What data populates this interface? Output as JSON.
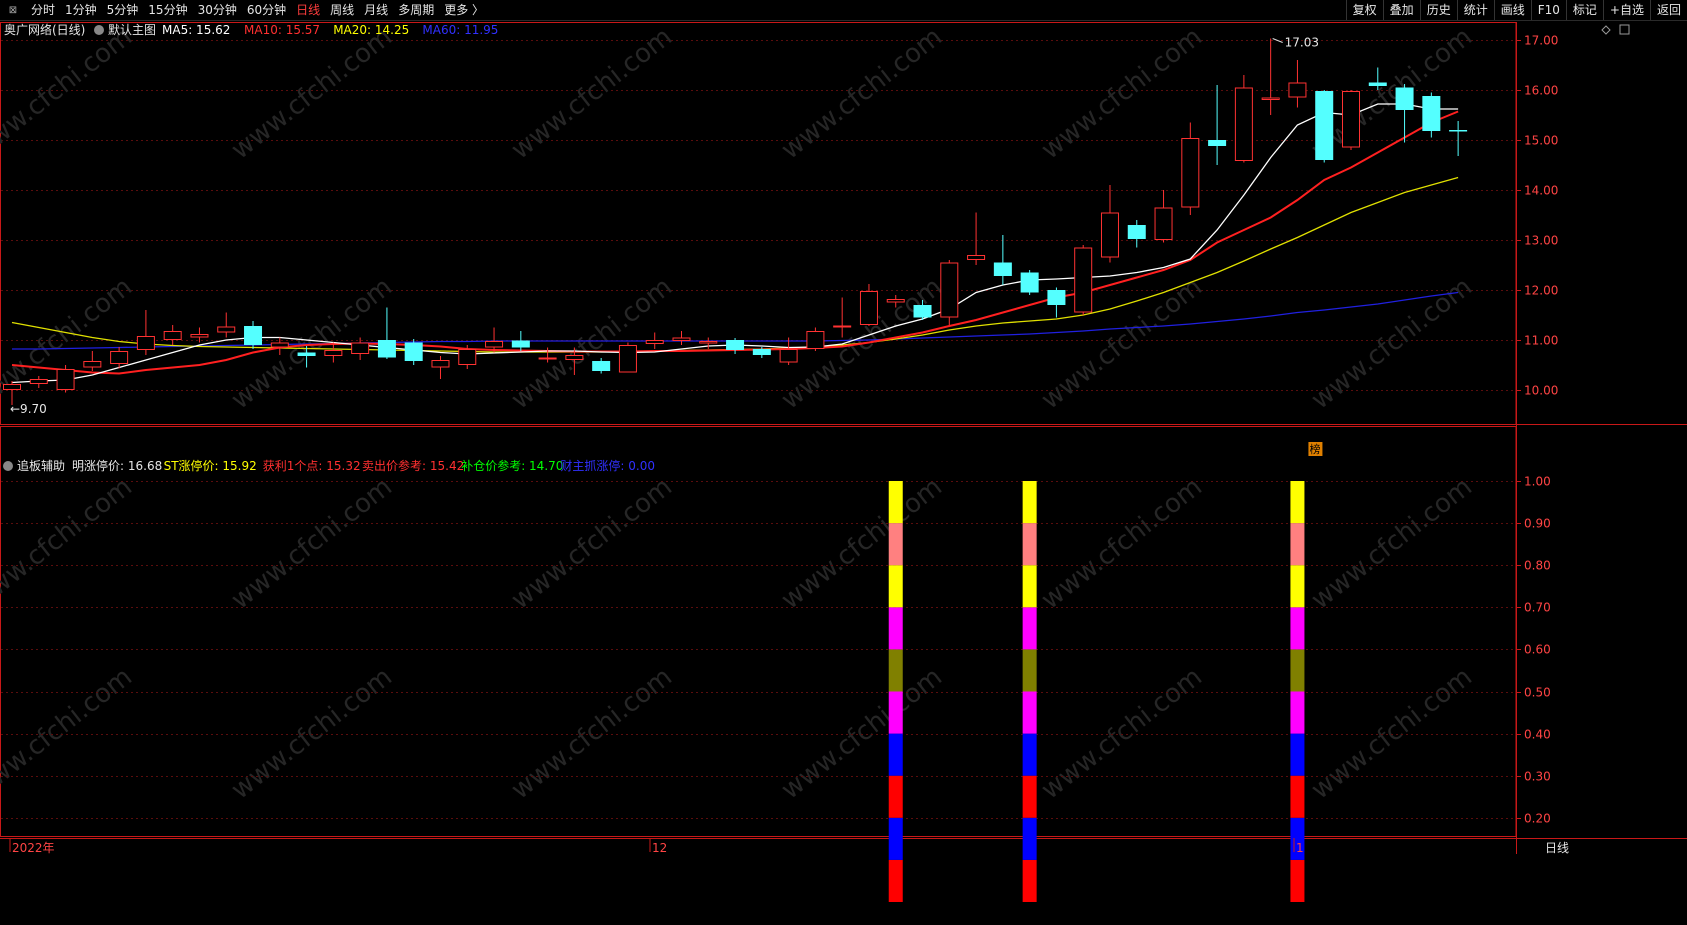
{
  "toolbar": {
    "left_items": [
      "分时",
      "1分钟",
      "5分钟",
      "15分钟",
      "30分钟",
      "60分钟",
      "日线",
      "周线",
      "月线",
      "多周期",
      "更多 〉"
    ],
    "active_index": 6,
    "right_items": [
      "复权",
      "叠加",
      "历史",
      "统计",
      "画线",
      "F10",
      "标记",
      "+自选",
      "返回"
    ]
  },
  "main_panel": {
    "stock_title": "奥广网络(日线)",
    "template_label": "默认主图",
    "ma_labels": [
      {
        "text": "MA5: 15.62",
        "color": "#ffffff"
      },
      {
        "text": "MA10: 15.57",
        "color": "#ff3030"
      },
      {
        "text": "MA20: 14.25",
        "color": "#ffff00"
      },
      {
        "text": "MA60: 11.95",
        "color": "#3030ff"
      }
    ],
    "high_label": "17.03",
    "low_label": "9.70",
    "tag_label": "榜"
  },
  "indicator_panel": {
    "name": "追板辅助",
    "labels": [
      {
        "text": "明涨停价: 16.68",
        "color": "#e6e6e6"
      },
      {
        "text": "ST涨停价: 15.92",
        "color": "#ffff00"
      },
      {
        "text": "获利1个点: 15.32",
        "color": "#ff3030"
      },
      {
        "text": "卖出价参考: 15.42",
        "color": "#ff3030"
      },
      {
        "text": "补仓价参考: 14.70",
        "color": "#00ff00"
      },
      {
        "text": "财主抓涨停: 0.00",
        "color": "#3030ff"
      }
    ]
  },
  "time_axis": {
    "labels": [
      "2022年",
      "12",
      "1"
    ],
    "period_label": "日线"
  },
  "watermark": "www.cfchi.com",
  "chart_data": [
    {
      "type": "candlestick",
      "ylim": [
        9.4,
        17.2
      ],
      "yticks": [
        10.0,
        11.0,
        12.0,
        13.0,
        14.0,
        15.0,
        16.0,
        17.0
      ],
      "candles": [
        {
          "o": 10.0,
          "h": 10.18,
          "l": 9.7,
          "c": 10.12
        },
        {
          "o": 10.12,
          "h": 10.28,
          "l": 10.04,
          "c": 10.22
        },
        {
          "o": 10.0,
          "h": 10.5,
          "l": 9.95,
          "c": 10.42
        },
        {
          "o": 10.45,
          "h": 10.78,
          "l": 10.38,
          "c": 10.58
        },
        {
          "o": 10.52,
          "h": 10.86,
          "l": 10.43,
          "c": 10.78
        },
        {
          "o": 10.8,
          "h": 11.6,
          "l": 10.7,
          "c": 11.08
        },
        {
          "o": 11.0,
          "h": 11.3,
          "l": 10.9,
          "c": 11.18
        },
        {
          "o": 11.05,
          "h": 11.25,
          "l": 10.95,
          "c": 11.12
        },
        {
          "o": 11.15,
          "h": 11.55,
          "l": 11.05,
          "c": 11.27
        },
        {
          "o": 11.28,
          "h": 11.38,
          "l": 10.82,
          "c": 10.9
        },
        {
          "o": 10.85,
          "h": 11.05,
          "l": 10.7,
          "c": 10.95
        },
        {
          "o": 10.75,
          "h": 10.88,
          "l": 10.45,
          "c": 10.68
        },
        {
          "o": 10.68,
          "h": 10.95,
          "l": 10.55,
          "c": 10.8
        },
        {
          "o": 10.72,
          "h": 11.05,
          "l": 10.6,
          "c": 10.95
        },
        {
          "o": 11.0,
          "h": 11.65,
          "l": 10.62,
          "c": 10.65
        },
        {
          "o": 10.95,
          "h": 11.02,
          "l": 10.5,
          "c": 10.58
        },
        {
          "o": 10.45,
          "h": 10.68,
          "l": 10.22,
          "c": 10.6
        },
        {
          "o": 10.5,
          "h": 10.9,
          "l": 10.42,
          "c": 10.82
        },
        {
          "o": 10.85,
          "h": 11.25,
          "l": 10.75,
          "c": 10.98
        },
        {
          "o": 10.99,
          "h": 11.18,
          "l": 10.78,
          "c": 10.85
        },
        {
          "o": 10.65,
          "h": 10.85,
          "l": 10.55,
          "c": 10.65
        },
        {
          "o": 10.6,
          "h": 10.85,
          "l": 10.3,
          "c": 10.7
        },
        {
          "o": 10.58,
          "h": 10.64,
          "l": 10.33,
          "c": 10.38
        },
        {
          "o": 10.35,
          "h": 10.95,
          "l": 10.35,
          "c": 10.9
        },
        {
          "o": 10.92,
          "h": 11.15,
          "l": 10.82,
          "c": 11.0
        },
        {
          "o": 10.98,
          "h": 11.18,
          "l": 10.9,
          "c": 11.05
        },
        {
          "o": 10.93,
          "h": 11.05,
          "l": 10.82,
          "c": 10.98
        },
        {
          "o": 11.0,
          "h": 11.04,
          "l": 10.72,
          "c": 10.8
        },
        {
          "o": 10.82,
          "h": 10.86,
          "l": 10.64,
          "c": 10.7
        },
        {
          "o": 10.55,
          "h": 11.05,
          "l": 10.5,
          "c": 10.82
        },
        {
          "o": 10.82,
          "h": 11.25,
          "l": 10.78,
          "c": 11.18
        },
        {
          "o": 11.27,
          "h": 11.85,
          "l": 11.05,
          "c": 11.29
        },
        {
          "o": 11.3,
          "h": 12.12,
          "l": 11.28,
          "c": 11.98
        },
        {
          "o": 11.75,
          "h": 11.9,
          "l": 11.65,
          "c": 11.82
        },
        {
          "o": 11.7,
          "h": 11.8,
          "l": 11.4,
          "c": 11.45
        },
        {
          "o": 11.45,
          "h": 12.6,
          "l": 11.3,
          "c": 12.55
        },
        {
          "o": 12.6,
          "h": 13.55,
          "l": 12.5,
          "c": 12.7
        },
        {
          "o": 12.55,
          "h": 13.1,
          "l": 12.1,
          "c": 12.28
        },
        {
          "o": 12.35,
          "h": 12.4,
          "l": 11.9,
          "c": 11.95
        },
        {
          "o": 12.0,
          "h": 12.05,
          "l": 11.45,
          "c": 11.7
        },
        {
          "o": 11.55,
          "h": 12.9,
          "l": 11.5,
          "c": 12.85
        },
        {
          "o": 12.65,
          "h": 14.1,
          "l": 12.55,
          "c": 13.55
        },
        {
          "o": 13.3,
          "h": 13.4,
          "l": 12.85,
          "c": 13.02
        },
        {
          "o": 13.0,
          "h": 14.0,
          "l": 12.95,
          "c": 13.65
        },
        {
          "o": 13.65,
          "h": 15.35,
          "l": 13.5,
          "c": 15.04
        },
        {
          "o": 15.0,
          "h": 16.1,
          "l": 14.5,
          "c": 14.88
        },
        {
          "o": 14.58,
          "h": 16.3,
          "l": 14.55,
          "c": 16.05
        },
        {
          "o": 15.8,
          "h": 17.03,
          "l": 15.5,
          "c": 15.85
        },
        {
          "o": 15.85,
          "h": 16.6,
          "l": 15.65,
          "c": 16.15
        },
        {
          "o": 15.98,
          "h": 16.0,
          "l": 14.55,
          "c": 14.6
        },
        {
          "o": 14.85,
          "h": 16.0,
          "l": 14.8,
          "c": 15.98
        },
        {
          "o": 16.15,
          "h": 16.45,
          "l": 16.0,
          "c": 16.08
        },
        {
          "o": 16.05,
          "h": 16.12,
          "l": 14.95,
          "c": 15.6
        },
        {
          "o": 15.88,
          "h": 15.95,
          "l": 15.05,
          "c": 15.18
        },
        {
          "o": 15.2,
          "h": 15.38,
          "l": 14.68,
          "c": 15.18
        }
      ],
      "ma5": [
        10.15,
        10.18,
        10.2,
        10.3,
        10.45,
        10.6,
        10.75,
        10.9,
        11.0,
        11.05,
        11.05,
        11.0,
        10.95,
        10.9,
        10.85,
        10.8,
        10.75,
        10.72,
        10.74,
        10.76,
        10.78,
        10.78,
        10.76,
        10.75,
        10.76,
        10.82,
        10.88,
        10.9,
        10.88,
        10.85,
        10.86,
        10.92,
        11.1,
        11.28,
        11.42,
        11.62,
        11.95,
        12.1,
        12.2,
        12.22,
        12.25,
        12.28,
        12.35,
        12.45,
        12.62,
        13.2,
        13.9,
        14.65,
        15.3,
        15.55,
        15.5,
        15.72,
        15.72,
        15.62,
        15.62
      ],
      "ma10": [
        10.5,
        10.45,
        10.4,
        10.35,
        10.33,
        10.4,
        10.45,
        10.5,
        10.6,
        10.75,
        10.85,
        10.9,
        10.92,
        10.93,
        10.92,
        10.9,
        10.87,
        10.82,
        10.8,
        10.79,
        10.78,
        10.77,
        10.77,
        10.77,
        10.78,
        10.78,
        10.79,
        10.8,
        10.81,
        10.82,
        10.84,
        10.87,
        10.95,
        11.05,
        11.15,
        11.28,
        11.4,
        11.55,
        11.7,
        11.85,
        11.95,
        12.1,
        12.25,
        12.4,
        12.6,
        12.95,
        13.2,
        13.45,
        13.8,
        14.2,
        14.45,
        14.75,
        15.05,
        15.35,
        15.57
      ],
      "ma20": [
        11.35,
        11.25,
        11.15,
        11.05,
        10.97,
        10.92,
        10.89,
        10.87,
        10.86,
        10.85,
        10.84,
        10.83,
        10.82,
        10.81,
        10.8,
        10.79,
        10.78,
        10.77,
        10.76,
        10.76,
        10.76,
        10.76,
        10.76,
        10.77,
        10.78,
        10.79,
        10.8,
        10.81,
        10.82,
        10.84,
        10.86,
        10.9,
        10.95,
        11.02,
        11.1,
        11.2,
        11.28,
        11.34,
        11.38,
        11.42,
        11.5,
        11.62,
        11.78,
        11.95,
        12.15,
        12.35,
        12.58,
        12.82,
        13.05,
        13.3,
        13.55,
        13.75,
        13.95,
        14.1,
        14.25
      ],
      "ma60": [
        10.82,
        10.82,
        10.83,
        10.84,
        10.85,
        10.86,
        10.87,
        10.88,
        10.89,
        10.9,
        10.91,
        10.92,
        10.93,
        10.94,
        10.95,
        10.96,
        10.97,
        10.97,
        10.98,
        10.98,
        10.98,
        10.98,
        10.98,
        10.98,
        10.98,
        10.98,
        10.98,
        10.98,
        10.98,
        10.98,
        10.98,
        10.99,
        11.0,
        11.02,
        11.04,
        11.06,
        11.08,
        11.1,
        11.12,
        11.15,
        11.18,
        11.22,
        11.25,
        11.28,
        11.32,
        11.37,
        11.42,
        11.48,
        11.55,
        11.6,
        11.66,
        11.72,
        11.8,
        11.88,
        11.95
      ]
    },
    {
      "type": "bar",
      "title": "追板辅助",
      "ylim": [
        0,
        1.0
      ],
      "yticks": [
        1.0,
        0.9,
        0.8,
        0.7,
        0.6,
        0.5,
        0.4,
        0.3,
        0.2
      ],
      "signal_candle_indices": [
        33,
        38,
        48
      ],
      "segment_colors": [
        "#ff0000",
        "#0000ff",
        "#ff0000",
        "#0000ff",
        "#ff00ff",
        "#808000",
        "#ff00ff",
        "#ffff00",
        "#ff8080",
        "#ffff00"
      ]
    }
  ]
}
